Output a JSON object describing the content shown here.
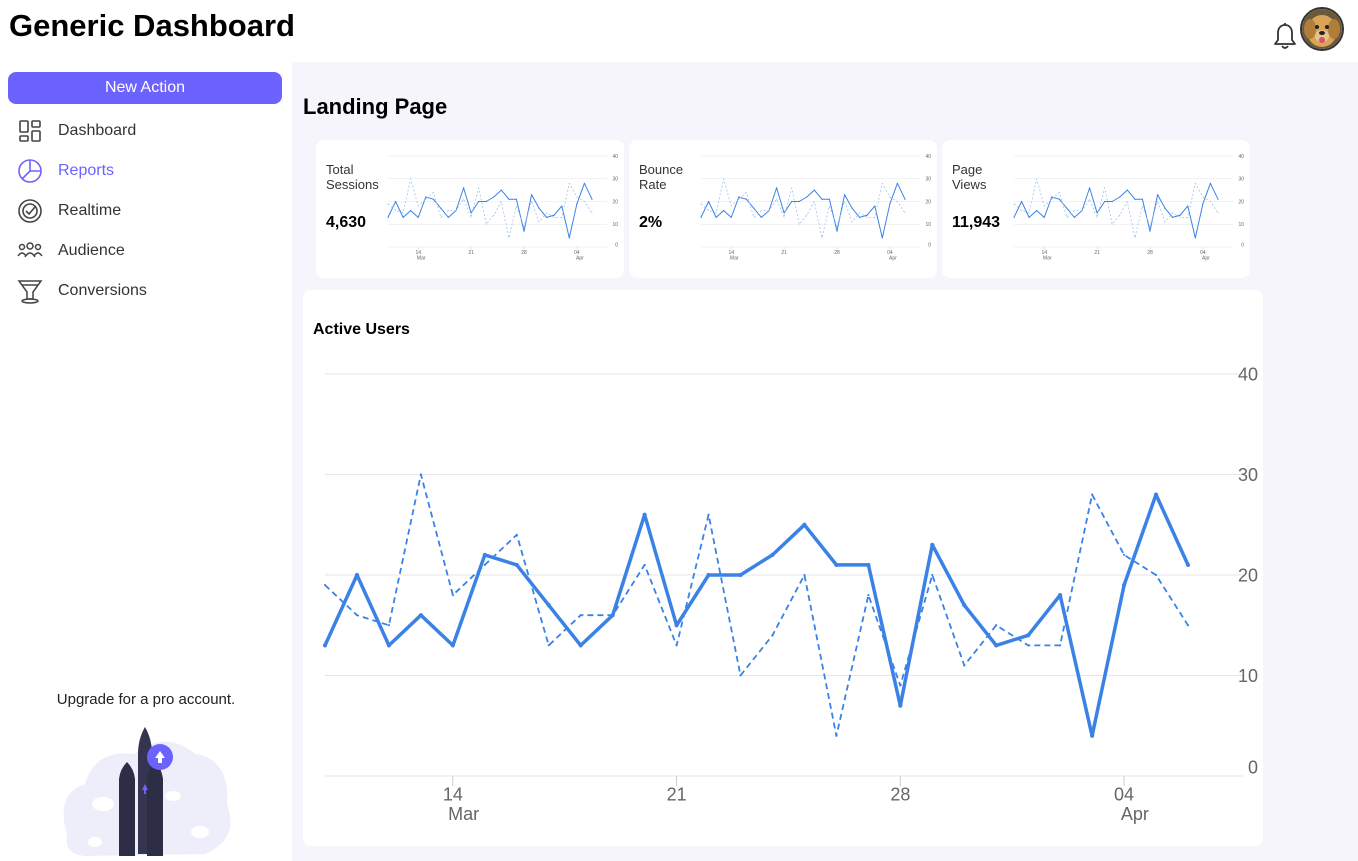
{
  "header": {
    "title": "Generic Dashboard"
  },
  "sidebar": {
    "new_action_label": "New Action",
    "items": [
      {
        "label": "Dashboard",
        "icon": "dashboard-grid-icon"
      },
      {
        "label": "Reports",
        "icon": "pie-chart-icon"
      },
      {
        "label": "Realtime",
        "icon": "check-circle-icon"
      },
      {
        "label": "Audience",
        "icon": "users-group-icon"
      },
      {
        "label": "Conversions",
        "icon": "funnel-icon"
      }
    ],
    "upgrade": {
      "link_text": "Upgrade",
      "rest_text": " for a pro account."
    }
  },
  "main": {
    "heading": "Landing Page",
    "kpis": [
      {
        "label": "Total Sessions",
        "value": "4,630"
      },
      {
        "label": "Bounce Rate",
        "value": "2%"
      },
      {
        "label": "Page Views",
        "value": "11,943"
      }
    ],
    "active_users_title": "Active Users"
  },
  "colors": {
    "accent": "#6c63ff",
    "series": "#3b82e6",
    "series_light": "#9ec3ef",
    "background": "#f5f5fb"
  },
  "chart_data": {
    "type": "line",
    "title": "Active Users",
    "x_tick_labels": [
      "14",
      "Mar",
      "21",
      "28",
      "04",
      "Apr"
    ],
    "y_ticks": [
      0,
      10,
      20,
      30,
      40
    ],
    "ylim": [
      0,
      40
    ],
    "y_axis_position": "right",
    "grid": true,
    "x": [
      "Mar 10",
      "Mar 11",
      "Mar 12",
      "Mar 13",
      "Mar 14",
      "Mar 15",
      "Mar 16",
      "Mar 17",
      "Mar 18",
      "Mar 19",
      "Mar 20",
      "Mar 21",
      "Mar 22",
      "Mar 23",
      "Mar 24",
      "Mar 25",
      "Mar 26",
      "Mar 27",
      "Mar 28",
      "Mar 29",
      "Mar 30",
      "Mar 31",
      "Apr 01",
      "Apr 02",
      "Apr 03",
      "Apr 04",
      "Apr 05",
      "Apr 06"
    ],
    "series": [
      {
        "style": "solid",
        "values": [
          13,
          20,
          13,
          16,
          13,
          22,
          21,
          17,
          13,
          16,
          26,
          15,
          20,
          20,
          22,
          25,
          21,
          21,
          7,
          23,
          17,
          13,
          14,
          18,
          4,
          19,
          28,
          21
        ]
      },
      {
        "style": "dashed",
        "values": [
          19,
          16,
          15,
          30,
          18,
          21,
          24,
          13,
          16,
          16,
          21,
          13,
          26,
          10,
          14,
          20,
          4,
          18,
          9,
          20,
          11,
          15,
          13,
          13,
          28,
          22,
          20,
          15
        ]
      }
    ]
  }
}
